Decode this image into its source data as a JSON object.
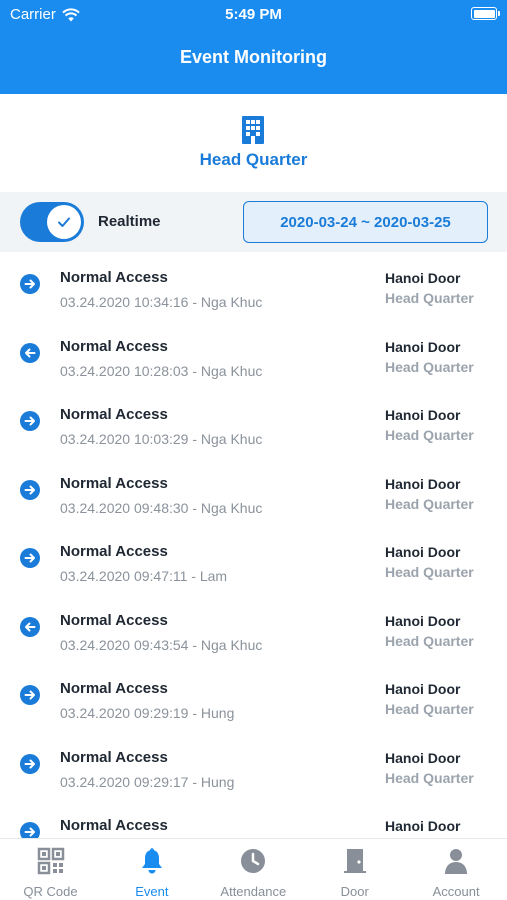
{
  "status_bar": {
    "carrier": "Carrier",
    "time": "5:49 PM"
  },
  "header": {
    "title": "Event Monitoring"
  },
  "site": {
    "icon": "building-icon",
    "name": "Head Quarter"
  },
  "filter": {
    "realtime_label": "Realtime",
    "realtime_on": true,
    "date_range": "2020-03-24 ~ 2020-03-25"
  },
  "events": [
    {
      "direction": "in",
      "type": "Normal Access",
      "meta": "03.24.2020 10:34:16 - Nga Khuc",
      "door": "Hanoi Door",
      "site": "Head Quarter"
    },
    {
      "direction": "out",
      "type": "Normal Access",
      "meta": "03.24.2020 10:28:03 - Nga Khuc",
      "door": "Hanoi Door",
      "site": "Head Quarter"
    },
    {
      "direction": "in",
      "type": "Normal Access",
      "meta": "03.24.2020 10:03:29 - Nga Khuc",
      "door": "Hanoi Door",
      "site": "Head Quarter"
    },
    {
      "direction": "in",
      "type": "Normal Access",
      "meta": "03.24.2020 09:48:30 - Nga Khuc",
      "door": "Hanoi Door",
      "site": "Head Quarter"
    },
    {
      "direction": "in",
      "type": "Normal Access",
      "meta": "03.24.2020 09:47:11 - Lam",
      "door": "Hanoi Door",
      "site": "Head Quarter"
    },
    {
      "direction": "out",
      "type": "Normal Access",
      "meta": "03.24.2020 09:43:54 - Nga Khuc",
      "door": "Hanoi Door",
      "site": "Head Quarter"
    },
    {
      "direction": "in",
      "type": "Normal Access",
      "meta": "03.24.2020 09:29:19 - Hung",
      "door": "Hanoi Door",
      "site": "Head Quarter"
    },
    {
      "direction": "in",
      "type": "Normal Access",
      "meta": "03.24.2020 09:29:17 - Hung",
      "door": "Hanoi Door",
      "site": "Head Quarter"
    },
    {
      "direction": "in",
      "type": "Normal Access",
      "meta": "",
      "door": "Hanoi Door",
      "site": ""
    }
  ],
  "tabs": [
    {
      "label": "QR Code",
      "icon": "qr-code-icon",
      "active": false
    },
    {
      "label": "Event",
      "icon": "bell-icon",
      "active": true
    },
    {
      "label": "Attendance",
      "icon": "clock-icon",
      "active": false
    },
    {
      "label": "Door",
      "icon": "door-icon",
      "active": false
    },
    {
      "label": "Account",
      "icon": "account-icon",
      "active": false
    }
  ],
  "colors": {
    "primary": "#1a8cf0",
    "accent": "#1a7cd8",
    "text": "#1f2833",
    "muted": "#8b929b",
    "tab_inactive": "#888f98"
  }
}
